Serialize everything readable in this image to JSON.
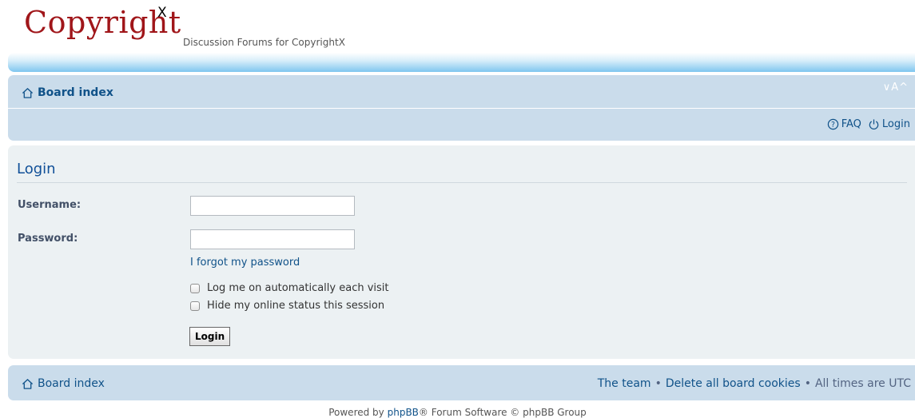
{
  "header": {
    "logo_text": "Copyright",
    "logo_superscript": "X",
    "tagline": "Discussion Forums for CopyrightX"
  },
  "navbar": {
    "board_index": "Board index",
    "font_size_control": "∨A^",
    "faq_label": "FAQ",
    "login_label": "Login",
    "icons": [
      "home-icon",
      "faq-icon",
      "power-icon"
    ]
  },
  "login": {
    "title": "Login",
    "username_label": "Username:",
    "username_value": "",
    "password_label": "Password:",
    "password_value": "",
    "forgot_link": "I forgot my password",
    "autologin_label": "Log me on automatically each visit",
    "autologin_checked": false,
    "hide_status_label": "Hide my online status this session",
    "hide_status_checked": false,
    "submit_label": "Login"
  },
  "footer": {
    "board_index": "Board index",
    "team_link": "The team",
    "separator": "•",
    "delete_cookies_link": "Delete all board cookies",
    "timezone_text": "All times are UTC"
  },
  "powered": {
    "prefix": "Powered by",
    "link": "phpBB",
    "suffix": "® Forum Software © phpBB Group"
  },
  "colors": {
    "link": "#105289",
    "logo": "#a0161a",
    "navbar_bg": "#cadceb",
    "panel_bg": "#ecf1f3"
  }
}
